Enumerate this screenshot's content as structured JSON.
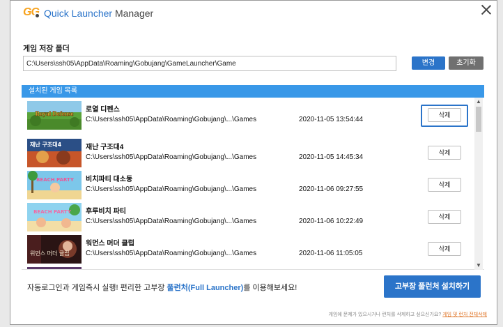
{
  "app": {
    "logo_text": "GG",
    "title_part1": "Quick Launcher",
    "title_part2": " Manager"
  },
  "folder": {
    "label": "게임 저장 폴더",
    "path": "C:\\Users\\ssh05\\AppData\\Roaming\\Gobujang\\GameLauncher\\Game",
    "change_label": "변경",
    "reset_label": "초기화"
  },
  "games": {
    "header": "설치된 게임 목록",
    "items": [
      {
        "name": "로열 디펜스",
        "path": "C:\\Users\\ssh05\\AppData\\Roaming\\Gobujang\\...\\Games",
        "date": "2020-11-05 13:54:44",
        "delete_label": "삭제",
        "thumb_text": "Royal Defense"
      },
      {
        "name": "재난 구조대4",
        "path": "C:\\Users\\ssh05\\AppData\\Roaming\\Gobujang\\...\\Games",
        "date": "2020-11-05 14:45:34",
        "delete_label": "삭제",
        "thumb_text": "재난 구조대4"
      },
      {
        "name": "비치파티 대소동",
        "path": "C:\\Users\\ssh05\\AppData\\Roaming\\Gobujang\\...\\Games",
        "date": "2020-11-06 09:27:55",
        "delete_label": "삭제",
        "thumb_text": "BEACH PARTY"
      },
      {
        "name": "후루비치 파티",
        "path": "C:\\Users\\ssh05\\AppData\\Roaming\\Gobujang\\...\\Games",
        "date": "2020-11-06 10:22:49",
        "delete_label": "삭제",
        "thumb_text": "BEACH PARTY"
      },
      {
        "name": "워먼스 머더 클럽",
        "path": "C:\\Users\\ssh05\\AppData\\Roaming\\Gobujang\\...\\Games",
        "date": "2020-11-06 11:05:05",
        "delete_label": "삭제",
        "thumb_text": "위먼스 머더 클럽"
      }
    ]
  },
  "promo": {
    "text_before": "자동로그인과 게임즉시 실행! 편리한 고부장 ",
    "highlight": "풀런처(Full Launcher)",
    "text_after": "를 이용해보세요!",
    "install_label": "고부장 풀런처 설치하기"
  },
  "footnote": {
    "text": "게임에 문제가 있으시거나 런처를 삭제하고 싶으신가요? ",
    "link": "게임 및 런처 전체삭제"
  },
  "colors": {
    "accent": "#2b74c9",
    "header_bar": "#3998e8",
    "reset_button": "#707070",
    "logo_orange": "#f7a21c",
    "footnote_link": "#e0772b"
  }
}
